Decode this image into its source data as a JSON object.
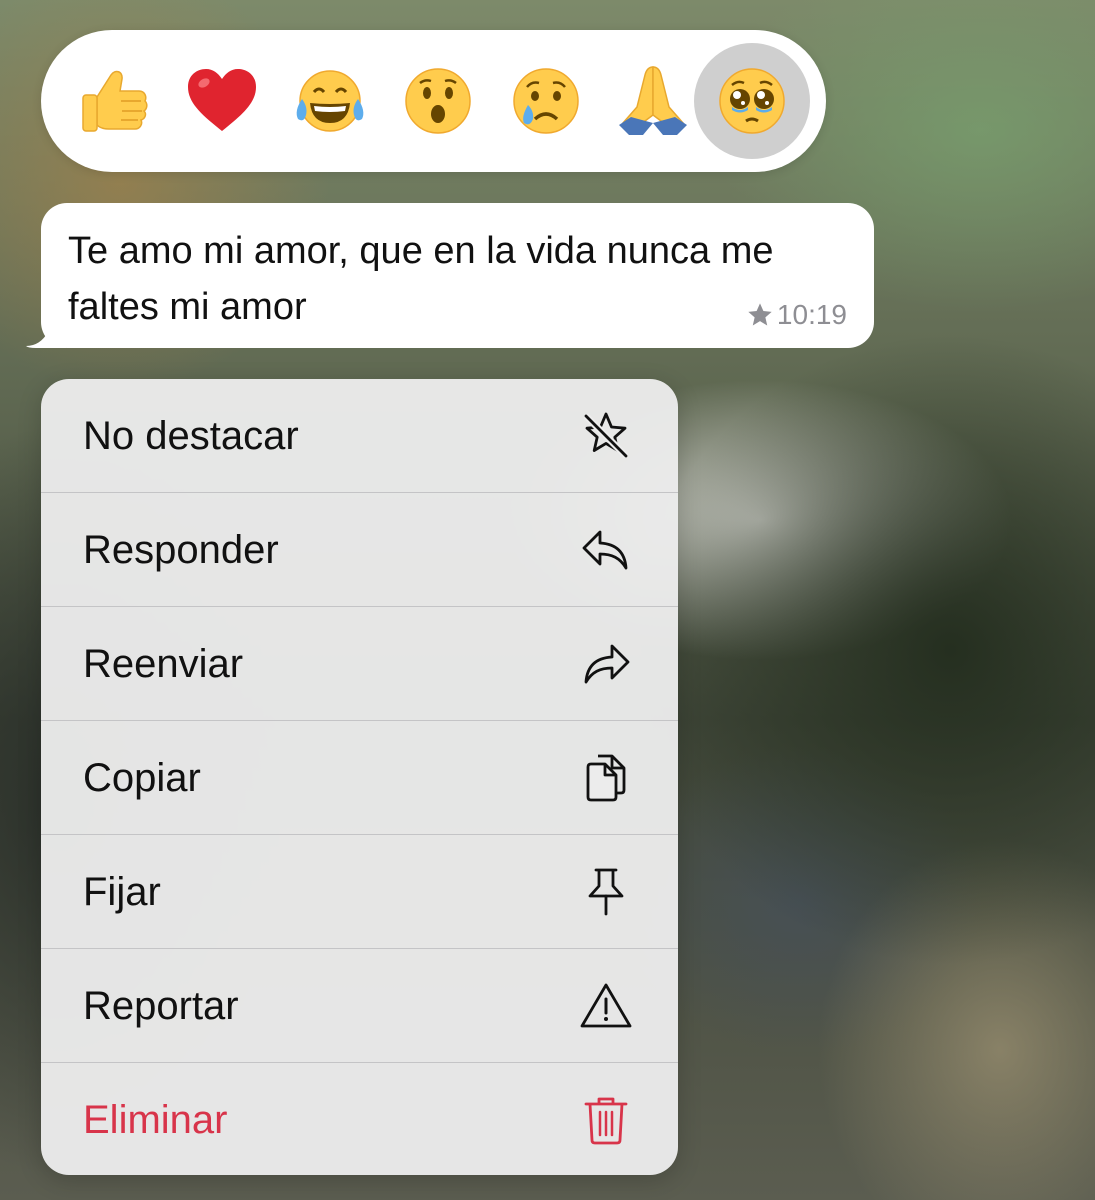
{
  "reactions": [
    {
      "name": "thumbs-up",
      "emoji": "👍",
      "selected": false
    },
    {
      "name": "red-heart",
      "emoji": "❤️",
      "selected": false
    },
    {
      "name": "tears-of-joy",
      "emoji": "😂",
      "selected": false
    },
    {
      "name": "surprised-face",
      "emoji": "😮",
      "selected": false
    },
    {
      "name": "sad-tear-face",
      "emoji": "😢",
      "selected": false
    },
    {
      "name": "folded-hands",
      "emoji": "🙏",
      "selected": false
    },
    {
      "name": "pleading-face",
      "emoji": "🥹",
      "selected": true
    }
  ],
  "message": {
    "text": "Te amo mi amor, que en la vida nunca me faltes mi amor",
    "time": "10:19",
    "starred": true
  },
  "menu": {
    "items": [
      {
        "label": "No destacar",
        "icon": "unstar-icon",
        "danger": false
      },
      {
        "label": "Responder",
        "icon": "reply-icon",
        "danger": false
      },
      {
        "label": "Reenviar",
        "icon": "forward-icon",
        "danger": false
      },
      {
        "label": "Copiar",
        "icon": "copy-icon",
        "danger": false
      },
      {
        "label": "Fijar",
        "icon": "pin-icon",
        "danger": false
      },
      {
        "label": "Reportar",
        "icon": "warning-icon",
        "danger": false
      },
      {
        "label": "Eliminar",
        "icon": "trash-icon",
        "danger": true
      }
    ]
  },
  "colors": {
    "danger": "#d8344a",
    "timestamp": "#8e8e93",
    "menu_background": "#ececec",
    "selected_reaction": "#cfcfcf"
  }
}
